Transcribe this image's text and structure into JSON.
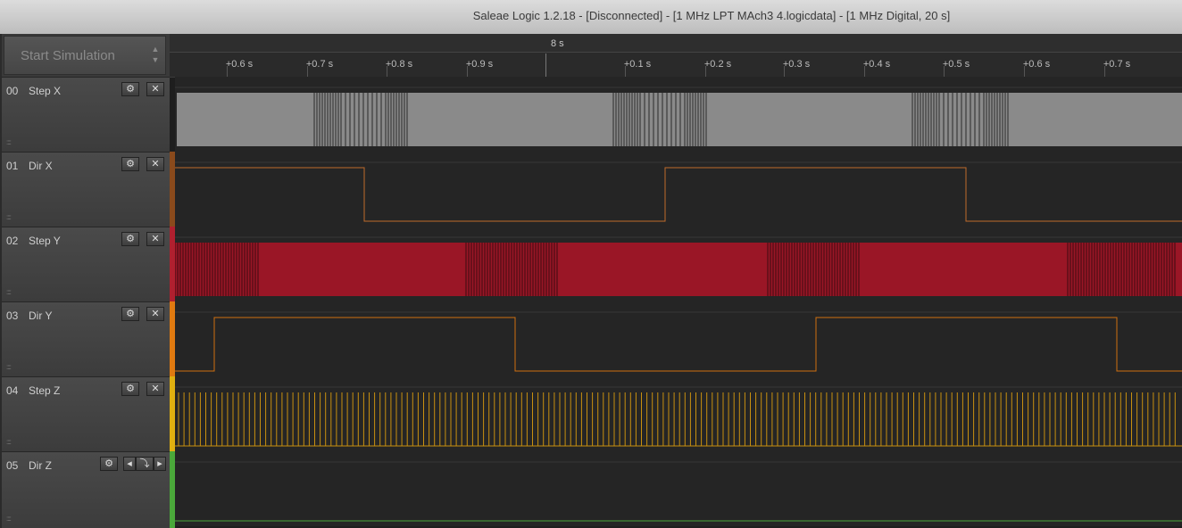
{
  "window": {
    "title": "Saleae Logic 1.2.18 - [Disconnected] - [1 MHz LPT MAch3 4.logicdata] - [1 MHz Digital, 20 s]"
  },
  "sidebar": {
    "start_simulation": "Start Simulation",
    "channels": [
      {
        "num": "00",
        "name": "Step X",
        "color": "#8a8a8a"
      },
      {
        "num": "01",
        "name": "Dir X",
        "color": "#8a4a1c"
      },
      {
        "num": "02",
        "name": "Step Y",
        "color": "#b0202f"
      },
      {
        "num": "03",
        "name": "Dir Y",
        "color": "#e07a10"
      },
      {
        "num": "04",
        "name": "Step Z",
        "color": "#e0b010"
      },
      {
        "num": "05",
        "name": "Dir Z",
        "color": "#4aa83a"
      }
    ]
  },
  "ruler": {
    "major_label": "8 s",
    "ticks": [
      "+0.6 s",
      "+0.7 s",
      "+0.8 s",
      "+0.9 s",
      "+0.1 s",
      "+0.2 s",
      "+0.3 s",
      "+0.4 s",
      "+0.5 s",
      "+0.6 s",
      "+0.7 s"
    ]
  },
  "icons": {
    "settings": "gear-icon",
    "close": "close-icon",
    "prev": "prev-edge-icon",
    "next": "next-edge-icon",
    "edge": "edge-icon"
  }
}
